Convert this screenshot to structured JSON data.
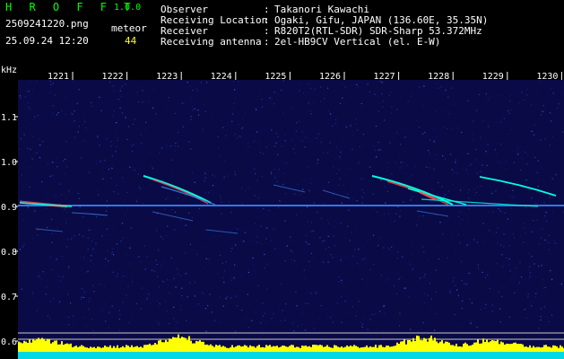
{
  "header": {
    "app_title": "H R O F F T",
    "version": "1.0.0",
    "filename": "2509241220.png",
    "datetime": "25.09.24 12:20",
    "meteor_label": "meteor",
    "meteor_count": "44"
  },
  "info": {
    "rows": [
      {
        "label": "Observer",
        "value": "Takanori Kawachi"
      },
      {
        "label": "Receiving Location",
        "value": "Ogaki, Gifu, JAPAN (136.60E, 35.35N)"
      },
      {
        "label": "Receiver",
        "value": "R820T2(RTL-SDR) SDR-Sharp 53.372MHz"
      },
      {
        "label": "Receiving antenna",
        "value": "2el-HB9CV Vertical (el. E-W)"
      }
    ]
  },
  "axis": {
    "y_unit": "kHz",
    "y_ticks": [
      "1.1",
      "1.0",
      "0.9",
      "0.8",
      "0.7",
      "0.6"
    ],
    "x_ticks": [
      "1221",
      "1222",
      "1223",
      "1224",
      "1225",
      "1226",
      "1227",
      "1228",
      "1229",
      "1230"
    ]
  },
  "colors": {
    "background": "#0a0a46",
    "text": "#ffffff",
    "title": "#00ff00",
    "counter": "#ffff00",
    "carrier": "#3a8cff",
    "echo": "#00ffe0",
    "echo_hot": "#ff5050",
    "level_bars": "#ffff00",
    "level_base": "#00ffff"
  }
}
